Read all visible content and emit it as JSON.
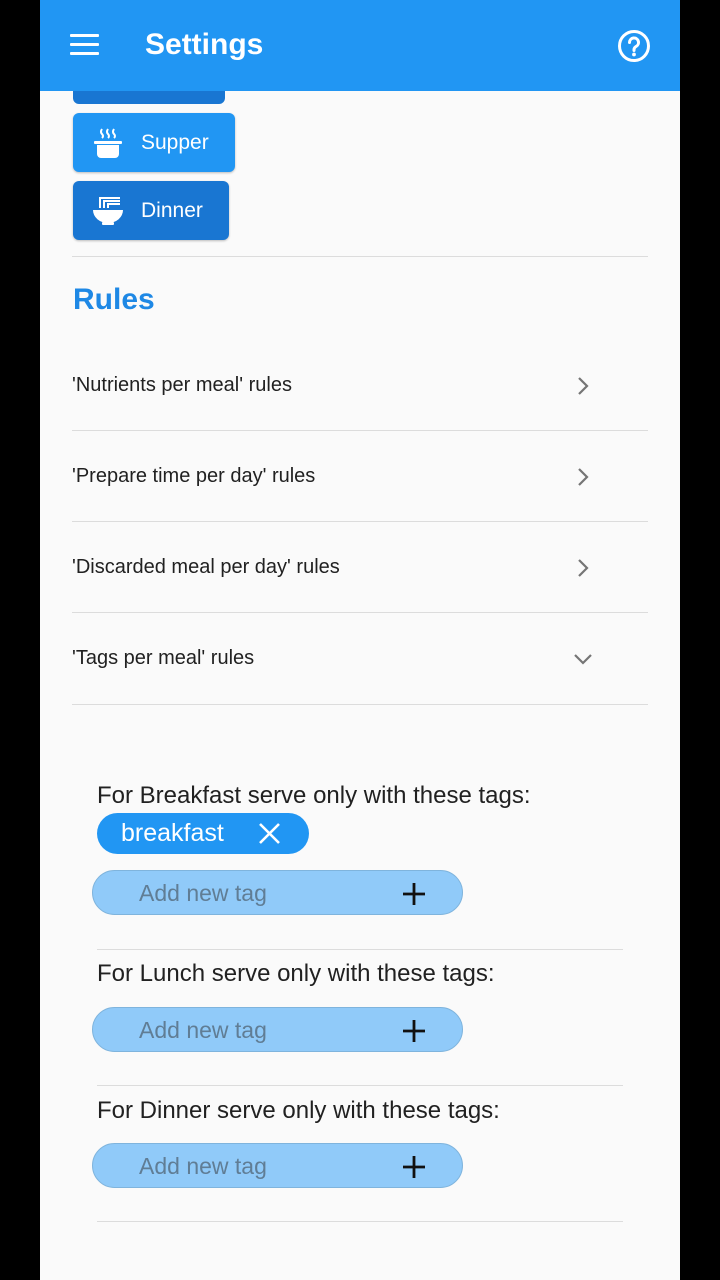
{
  "app_bar": {
    "title": "Settings",
    "menu_icon": "menu-icon",
    "help_icon": "help-circle-icon"
  },
  "meal_buttons": [
    {
      "label": "Supper",
      "icon": "pot-icon"
    },
    {
      "label": "Dinner",
      "icon": "noodle-bowl-icon"
    }
  ],
  "rules": {
    "title": "Rules",
    "items": [
      {
        "label": "'Nutrients per meal' rules",
        "state": "collapsed"
      },
      {
        "label": "'Prepare time per day' rules",
        "state": "collapsed"
      },
      {
        "label": "'Discarded meal per day' rules",
        "state": "collapsed"
      },
      {
        "label": "'Tags per meal' rules",
        "state": "expanded"
      }
    ]
  },
  "tag_rules": [
    {
      "label": "For Breakfast serve only with these tags:",
      "tags": [
        "breakfast"
      ],
      "add_placeholder": "Add new tag"
    },
    {
      "label": "For Lunch serve only with these tags:",
      "tags": [],
      "add_placeholder": "Add new tag"
    },
    {
      "label": "For Dinner serve only with these tags:",
      "tags": [],
      "add_placeholder": "Add new tag"
    }
  ],
  "colors": {
    "primary": "#2196f3",
    "primary_dark": "#1976d2",
    "tag_field": "#90caf9",
    "heading": "#1e88e5"
  }
}
